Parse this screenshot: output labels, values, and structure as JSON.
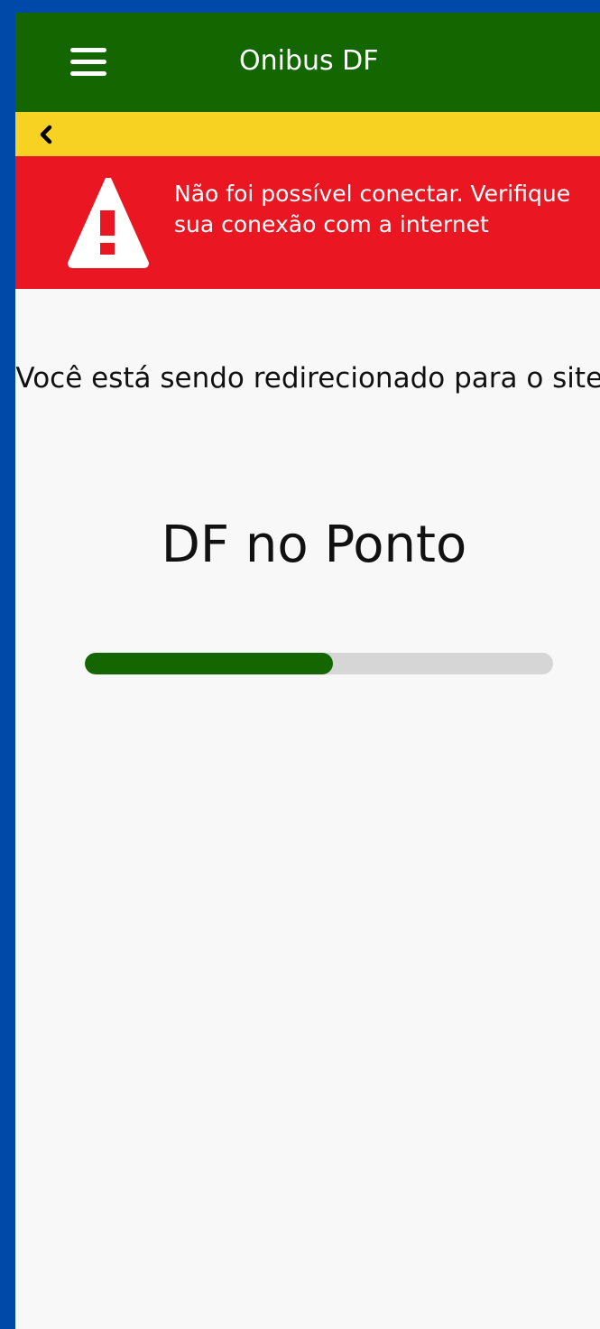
{
  "header": {
    "title": "Onibus DF",
    "menu_icon": "hamburger-menu-icon",
    "background": "#136600"
  },
  "nav": {
    "back_icon": "chevron-left-icon",
    "background": "#f8d223"
  },
  "alert": {
    "icon": "warning-triangle-icon",
    "message": "Não foi possível conectar. Verifique sua conexão com a internet",
    "background": "#ea1723"
  },
  "main": {
    "redirect_message": "Você está sendo redirecionado para o site:",
    "site_name": "DF no Ponto",
    "progress": 0.53,
    "progress_color": "#136600",
    "track_color": "#d6d6d6"
  },
  "frame_color": "#0049a8"
}
